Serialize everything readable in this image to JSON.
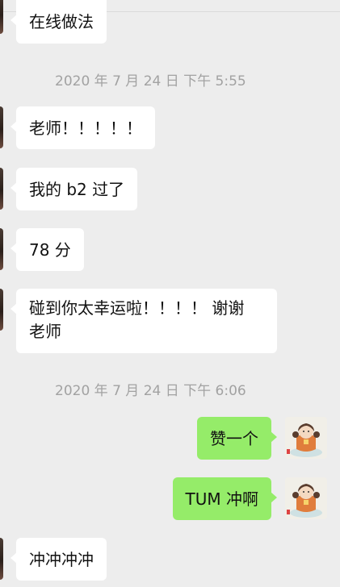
{
  "messages": [
    {
      "side": "left",
      "text": "在线做法"
    },
    {
      "side": "left",
      "text": "老师！！！！！"
    },
    {
      "side": "left",
      "text": "我的 b2 过了"
    },
    {
      "side": "left",
      "text": "78 分"
    },
    {
      "side": "left",
      "text_line1": "碰到你太幸运啦！！！！ 谢谢",
      "text_line2": "老师"
    },
    {
      "side": "right",
      "text": "赞一个"
    },
    {
      "side": "right",
      "text": "TUM 冲啊"
    },
    {
      "side": "left",
      "text": "冲冲冲冲"
    }
  ],
  "timestamps": [
    "2020 年 7 月 24 日 下午 5:55",
    "2020 年 7 月 24 日 下午 6:06"
  ],
  "icons": {
    "left_avatar": "contact-avatar-icon",
    "right_avatar": "self-avatar-icon"
  },
  "colors": {
    "background": "#ededed",
    "incoming_bubble": "#ffffff",
    "outgoing_bubble": "#95ec69",
    "timestamp_text": "#a2a2a2"
  }
}
